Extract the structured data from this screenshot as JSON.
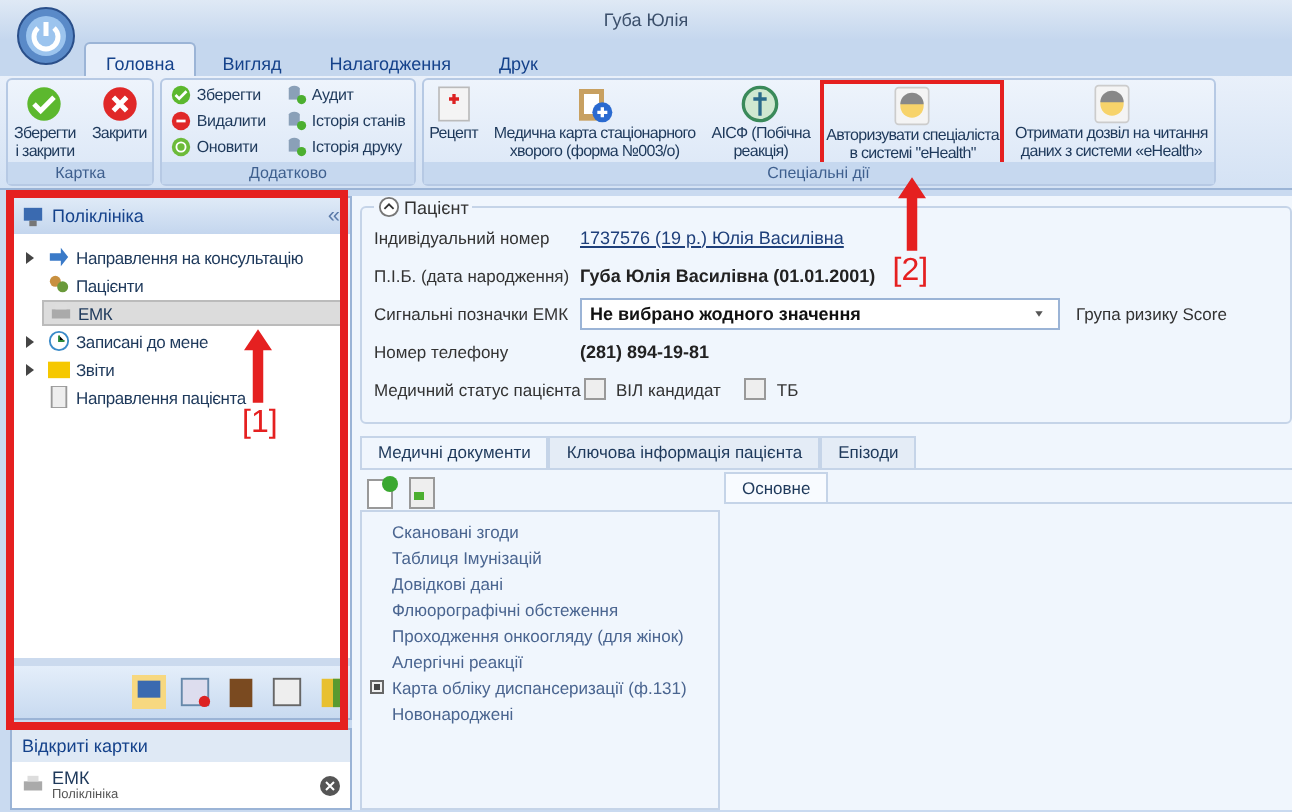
{
  "window": {
    "title": "Губа Юлія"
  },
  "app_tabs": [
    {
      "label": "Головна",
      "selected": true
    },
    {
      "label": "Вигляд",
      "selected": false
    },
    {
      "label": "Налагодження",
      "selected": false
    },
    {
      "label": "Друк",
      "selected": false
    }
  ],
  "ribbon": {
    "groups": [
      {
        "title": "Картка",
        "buttons": [
          {
            "kind": "large",
            "lines": [
              "Зберегти",
              "і закрити"
            ]
          },
          {
            "kind": "large",
            "lines": [
              "Закрити"
            ]
          }
        ]
      },
      {
        "title": "Додатково",
        "buttons": [
          {
            "kind": "small",
            "lines": [
              "Зберегти"
            ]
          },
          {
            "kind": "small",
            "lines": [
              "Видалити"
            ]
          },
          {
            "kind": "small",
            "lines": [
              "Оновити"
            ]
          },
          {
            "kind": "small",
            "lines": [
              "Аудит"
            ]
          },
          {
            "kind": "small",
            "lines": [
              "Історія станів"
            ]
          },
          {
            "kind": "small",
            "lines": [
              "Історія друку"
            ]
          }
        ]
      },
      {
        "title": "Спеціальні дії",
        "buttons": [
          {
            "kind": "large",
            "lines": [
              "Рецепт"
            ]
          },
          {
            "kind": "large",
            "lines": [
              "Медична карта стаціонарного",
              "хворого (форма №003/о)"
            ]
          },
          {
            "kind": "large",
            "lines": [
              "АІСФ (Побічна",
              "реакція)"
            ]
          },
          {
            "kind": "large",
            "lines": [
              "Авторизувати спеціаліста",
              "в системі \"eHealth\""
            ]
          },
          {
            "kind": "large",
            "lines": [
              "Отримати дозвіл на читання",
              "даних з системи «eHealth»"
            ]
          }
        ]
      }
    ]
  },
  "nav_panel": {
    "title": "Поліклініка",
    "collapse": "«",
    "items": [
      {
        "label": "Направлення на консультацію",
        "expandable": true,
        "selected": false
      },
      {
        "label": "Пацієнти",
        "expandable": false,
        "selected": false
      },
      {
        "label": "ЕМК",
        "expandable": false,
        "selected": true
      },
      {
        "label": "Записані до мене",
        "expandable": true,
        "selected": false
      },
      {
        "label": "Звіти",
        "expandable": true,
        "selected": false
      },
      {
        "label": "Направлення пацієнта",
        "expandable": false,
        "selected": false
      }
    ]
  },
  "open_cards": {
    "title": "Відкриті картки",
    "items": [
      {
        "title": "ЕМК",
        "subtitle": "Поліклініка"
      }
    ]
  },
  "patient": {
    "title": "Пацієнт",
    "fields": [
      {
        "kind": "link",
        "label": "Індивідуальний номер",
        "value": "1737576 (19 р.) Юлія Василівна"
      },
      {
        "kind": "bold",
        "label": "П.І.Б. (дата народження)",
        "value": "Губа Юлія Василівна (01.01.2001)"
      },
      {
        "kind": "dropdown",
        "label": "Сигнальні позначки ЕМК",
        "value": "Не вибрано жодного значення",
        "extra": "Група ризику Score"
      },
      {
        "kind": "bold",
        "label": "Номер телефону",
        "value": "(281) 894-19-81"
      },
      {
        "kind": "checks",
        "label": "Медичний статус пацієнта",
        "options": [
          {
            "label": "ВІЛ кандидат",
            "checked": false
          },
          {
            "label": "ТБ",
            "checked": false
          }
        ]
      }
    ]
  },
  "doc_tabs": [
    {
      "label": "Медичні документи",
      "selected": true
    },
    {
      "label": "Ключова інформація пацієнта",
      "selected": false
    },
    {
      "label": "Епізоди",
      "selected": false
    }
  ],
  "documents": [
    {
      "label": "Скановані згоди",
      "expandable": false
    },
    {
      "label": "Таблиця Імунізацій",
      "expandable": false
    },
    {
      "label": "Довідкові дані",
      "expandable": false
    },
    {
      "label": "Флюорографічні обстеження",
      "expandable": false
    },
    {
      "label": "Проходження онкоогляду (для жінок)",
      "expandable": false
    },
    {
      "label": "Алергічні реакції",
      "expandable": false
    },
    {
      "label": "Карта обліку диспансеризації (ф.131)",
      "expandable": true
    },
    {
      "label": "Новонароджені",
      "expandable": false
    }
  ],
  "detail_tabs": [
    {
      "label": "Основне",
      "selected": true
    }
  ],
  "annotations": [
    {
      "label": "[1]"
    },
    {
      "label": "[2]"
    }
  ]
}
